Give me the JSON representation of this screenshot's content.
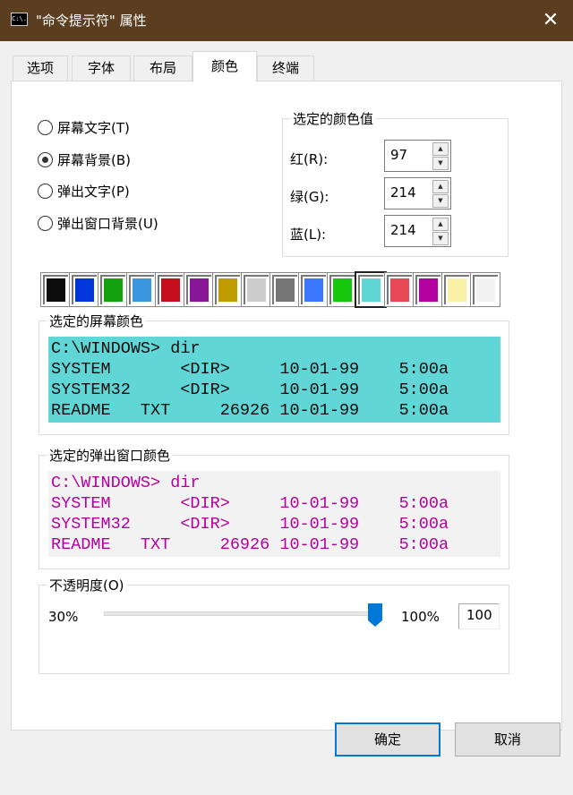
{
  "window": {
    "title": "\"命令提示符\" 属性",
    "icon": "cmd-icon",
    "close": "✕"
  },
  "tabs": [
    "选项",
    "字体",
    "布局",
    "颜色",
    "终端"
  ],
  "active_tab": "颜色",
  "radios": [
    {
      "label": "屏幕文字(T)",
      "checked": false
    },
    {
      "label": "屏幕背景(B)",
      "checked": true
    },
    {
      "label": "弹出文字(P)",
      "checked": false
    },
    {
      "label": "弹出窗口背景(U)",
      "checked": false
    }
  ],
  "color_values": {
    "title": "选定的颜色值",
    "red_label": "红(R):",
    "red": "97",
    "green_label": "绿(G):",
    "green": "214",
    "blue_label": "蓝(L):",
    "blue": "214"
  },
  "palette": [
    "#0C0C0C",
    "#0037DA",
    "#13A10E",
    "#3A96DD",
    "#C50F1F",
    "#881798",
    "#C19C00",
    "#CCCCCC",
    "#767676",
    "#3B78FF",
    "#16C60C",
    "#61D6D6",
    "#E74856",
    "#B4009E",
    "#F9F1A5",
    "#F2F2F2"
  ],
  "selected_palette_index": 11,
  "screen_preview": {
    "title": "选定的屏幕颜色",
    "bg": "#61D6D6",
    "fg": "#0C0C0C",
    "lines": [
      "C:\\WINDOWS> dir",
      "SYSTEM       <DIR>     10-01-99    5:00a",
      "SYSTEM32     <DIR>     10-01-99    5:00a",
      "README   TXT     26926 10-01-99    5:00a"
    ]
  },
  "popup_preview": {
    "title": "选定的弹出窗口颜色",
    "bg": "#F2F2F2",
    "fg": "#B4009E",
    "lines": [
      "C:\\WINDOWS> dir",
      "SYSTEM       <DIR>     10-01-99    5:00a",
      "SYSTEM32     <DIR>     10-01-99    5:00a",
      "README   TXT     26926 10-01-99    5:00a"
    ]
  },
  "opacity": {
    "title": "不透明度(O)",
    "min_label": "30%",
    "max_label": "100%",
    "value": "100",
    "min": 30,
    "max": 100
  },
  "buttons": {
    "ok": "确定",
    "cancel": "取消"
  }
}
